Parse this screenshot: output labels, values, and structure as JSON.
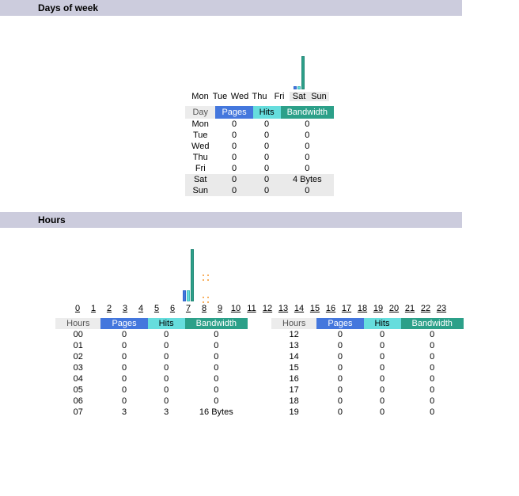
{
  "daysSection": {
    "title": "Days of week",
    "labels": [
      "Mon",
      "Tue",
      "Wed",
      "Thu",
      "Fri",
      "Sat",
      "Sun"
    ],
    "headers": {
      "day": "Day",
      "pages": "Pages",
      "hits": "Hits",
      "bw": "Bandwidth"
    },
    "rows": [
      {
        "day": "Mon",
        "pages": "0",
        "hits": "0",
        "bw": "0",
        "weekend": false
      },
      {
        "day": "Tue",
        "pages": "0",
        "hits": "0",
        "bw": "0",
        "weekend": false
      },
      {
        "day": "Wed",
        "pages": "0",
        "hits": "0",
        "bw": "0",
        "weekend": false
      },
      {
        "day": "Thu",
        "pages": "0",
        "hits": "0",
        "bw": "0",
        "weekend": false
      },
      {
        "day": "Fri",
        "pages": "0",
        "hits": "0",
        "bw": "0",
        "weekend": false
      },
      {
        "day": "Sat",
        "pages": "0",
        "hits": "0",
        "bw": "4 Bytes",
        "weekend": true
      },
      {
        "day": "Sun",
        "pages": "0",
        "hits": "0",
        "bw": "0",
        "weekend": true
      }
    ]
  },
  "hoursSection": {
    "title": "Hours",
    "labels": [
      "0",
      "1",
      "2",
      "3",
      "4",
      "5",
      "6",
      "7",
      "8",
      "9",
      "10",
      "11",
      "12",
      "13",
      "14",
      "15",
      "16",
      "17",
      "18",
      "19",
      "20",
      "21",
      "22",
      "23"
    ],
    "headers": {
      "hours": "Hours",
      "pages": "Pages",
      "hits": "Hits",
      "bw": "Bandwidth"
    },
    "left": [
      {
        "h": "00",
        "p": "0",
        "hi": "0",
        "bw": "0"
      },
      {
        "h": "01",
        "p": "0",
        "hi": "0",
        "bw": "0"
      },
      {
        "h": "02",
        "p": "0",
        "hi": "0",
        "bw": "0"
      },
      {
        "h": "03",
        "p": "0",
        "hi": "0",
        "bw": "0"
      },
      {
        "h": "04",
        "p": "0",
        "hi": "0",
        "bw": "0"
      },
      {
        "h": "05",
        "p": "0",
        "hi": "0",
        "bw": "0"
      },
      {
        "h": "06",
        "p": "0",
        "hi": "0",
        "bw": "0"
      },
      {
        "h": "07",
        "p": "3",
        "hi": "3",
        "bw": "16 Bytes"
      }
    ],
    "right": [
      {
        "h": "12",
        "p": "0",
        "hi": "0",
        "bw": "0"
      },
      {
        "h": "13",
        "p": "0",
        "hi": "0",
        "bw": "0"
      },
      {
        "h": "14",
        "p": "0",
        "hi": "0",
        "bw": "0"
      },
      {
        "h": "15",
        "p": "0",
        "hi": "0",
        "bw": "0"
      },
      {
        "h": "16",
        "p": "0",
        "hi": "0",
        "bw": "0"
      },
      {
        "h": "17",
        "p": "0",
        "hi": "0",
        "bw": "0"
      },
      {
        "h": "18",
        "p": "0",
        "hi": "0",
        "bw": "0"
      },
      {
        "h": "19",
        "p": "0",
        "hi": "0",
        "bw": "0"
      }
    ]
  },
  "chart_data": [
    {
      "type": "bar",
      "title": "Days of week",
      "categories": [
        "Mon",
        "Tue",
        "Wed",
        "Thu",
        "Fri",
        "Sat",
        "Sun"
      ],
      "series": [
        {
          "name": "Pages",
          "values": [
            0,
            0,
            0,
            0,
            0,
            0,
            0
          ]
        },
        {
          "name": "Hits",
          "values": [
            0,
            0,
            0,
            0,
            0,
            0,
            0
          ]
        },
        {
          "name": "Bandwidth",
          "values": [
            0,
            0,
            0,
            0,
            0,
            4,
            0
          ]
        }
      ],
      "xlabel": "",
      "ylabel": "",
      "ylim": [
        0,
        10
      ]
    },
    {
      "type": "bar",
      "title": "Hours",
      "categories": [
        "0",
        "1",
        "2",
        "3",
        "4",
        "5",
        "6",
        "7",
        "8",
        "9",
        "10",
        "11",
        "12",
        "13",
        "14",
        "15",
        "16",
        "17",
        "18",
        "19",
        "20",
        "21",
        "22",
        "23"
      ],
      "series": [
        {
          "name": "Pages",
          "values": [
            0,
            0,
            0,
            0,
            0,
            0,
            0,
            3,
            0,
            0,
            0,
            0,
            0,
            0,
            0,
            0,
            0,
            0,
            0,
            0,
            0,
            0,
            0,
            0
          ]
        },
        {
          "name": "Hits",
          "values": [
            0,
            0,
            0,
            0,
            0,
            0,
            0,
            3,
            0,
            0,
            0,
            0,
            0,
            0,
            0,
            0,
            0,
            0,
            0,
            0,
            0,
            0,
            0,
            0
          ]
        },
        {
          "name": "Bandwidth",
          "values": [
            0,
            0,
            0,
            0,
            0,
            0,
            0,
            16,
            0,
            0,
            0,
            0,
            0,
            0,
            0,
            0,
            0,
            0,
            0,
            0,
            0,
            0,
            0,
            0
          ]
        }
      ],
      "xlabel": "",
      "ylabel": "",
      "ylim": [
        0,
        20
      ]
    }
  ]
}
